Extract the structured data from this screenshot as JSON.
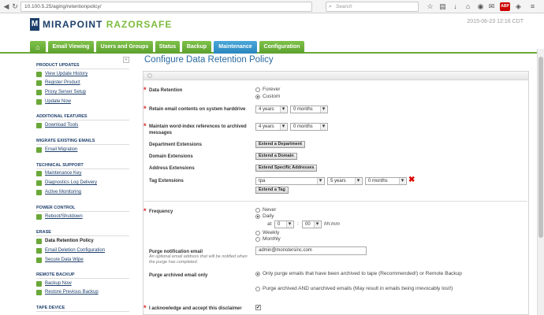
{
  "browser": {
    "url": "10.100.5.25/aging/retentionpolicy/",
    "search_placeholder": "Search"
  },
  "header": {
    "logo_main": "MIRAPOINT",
    "logo_accent": "RAZORSAFE",
    "timestamp": "2015-06-23 12:16 CDT"
  },
  "tabs": [
    "Email Viewing",
    "Users and Groups",
    "Status",
    "Backup",
    "Maintenance",
    "Configuration"
  ],
  "sidebar": {
    "sections": [
      {
        "title": "PRODUCT UPDATES",
        "items": [
          "View Update History",
          "Register Product",
          "Proxy Server Setup",
          "Update Now"
        ]
      },
      {
        "title": "ADDITIONAL FEATURES",
        "items": [
          "Download Tools"
        ]
      },
      {
        "title": "MIGRATE EXISTING EMAILS",
        "items": [
          "Email Migration"
        ]
      },
      {
        "title": "TECHNICAL SUPPORT",
        "items": [
          "Maintenance Key",
          "Diagnostics Log Delivery",
          "Active Monitoring"
        ]
      },
      {
        "title": "POWER CONTROL",
        "items": [
          "Reboot/Shutdown"
        ]
      },
      {
        "title": "ERASE",
        "items": [
          "Data Retention Policy",
          "Email Deletion Configuration",
          "Secure Data Wipe"
        ]
      },
      {
        "title": "REMOTE BACKUP",
        "items": [
          "Backup Now",
          "Restore Previous Backup"
        ]
      },
      {
        "title": "TAPE DEVICE",
        "items": []
      }
    ]
  },
  "main": {
    "title": "Configure Data Retention Policy",
    "data_retention": {
      "label": "Data Retention",
      "options": [
        "Forever",
        "Custom"
      ],
      "selected": "Custom"
    },
    "retain_contents": {
      "label": "Retain email contents on system harddrive",
      "years": "4 years",
      "months": "0 months"
    },
    "maintain_index": {
      "label": "Maintain word-index references to archived messages",
      "years": "4 years",
      "months": "0 months"
    },
    "department_ext": {
      "label": "Department Extensions",
      "button": "Extend a Department"
    },
    "domain_ext": {
      "label": "Domain Extensions",
      "button": "Extend a Domain"
    },
    "address_ext": {
      "label": "Address Extensions",
      "button": "Extend Specific Addresses"
    },
    "tag_ext": {
      "label": "Tag Extensions",
      "tag": "tpa",
      "years": "5 years",
      "months": "0 months",
      "button": "Extend a Tag"
    },
    "frequency": {
      "label": "Frequency",
      "options": [
        "Never",
        "Daily",
        "Weekly",
        "Monthly"
      ],
      "selected": "Daily",
      "at_label": "at",
      "hour": "0",
      "colon": ":",
      "minute": "00",
      "format": "hh:mm"
    },
    "purge_email": {
      "label": "Purge notification email",
      "help": "An optional email address that will be notified when the purge has completed.",
      "value": "admin@monstersinc.com"
    },
    "purge_archived": {
      "label": "Purge archived email only",
      "options": [
        "Only purge emails that have been archived to tape (Recommended!) or Remote Backup",
        "Purge archived AND unarchived emails (May result in emails being irrevocably lost!)"
      ],
      "selected": 0
    },
    "acknowledge": {
      "label": "I acknowledge and accept this disclaimer",
      "check": "✔"
    }
  }
}
